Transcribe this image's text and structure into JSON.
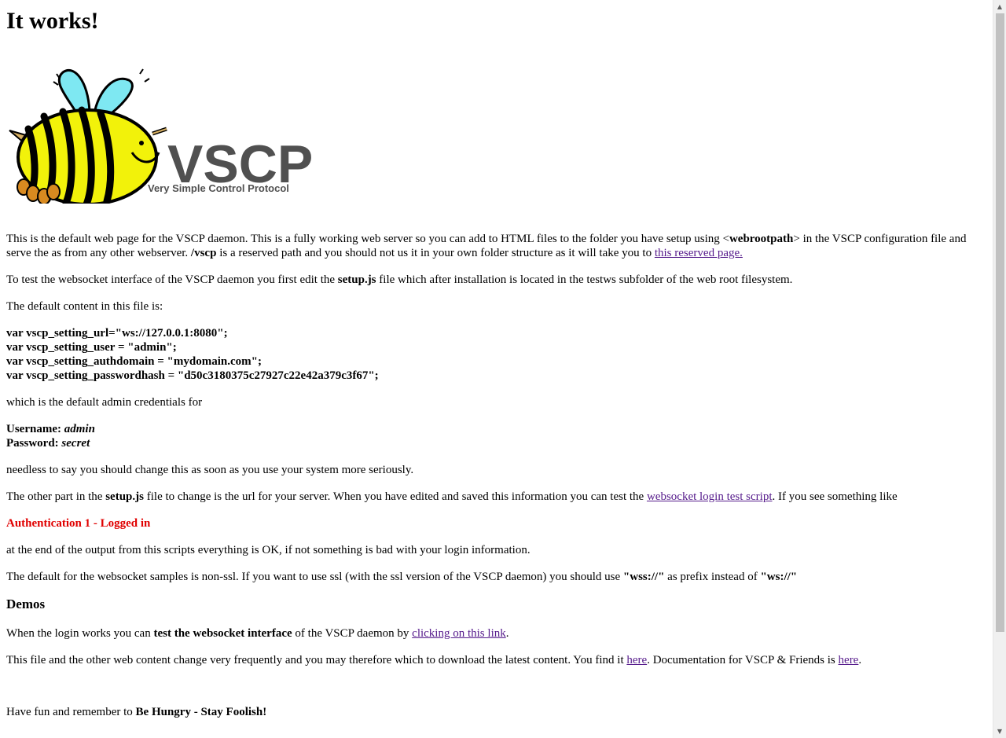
{
  "title": "It works!",
  "logo": {
    "wordmark": "VSCP",
    "tagline": "Very Simple Control Protocol"
  },
  "intro": {
    "t1": "This is the default web page for the VSCP daemon. This is a fully working web server so you can add to HTML files to the folder you have setup using <",
    "b1": "webrootpath",
    "t2": "> in the VSCP configuration file and serve the as from any other webserver. ",
    "b2": "/vscp",
    "t3": " is a reserved path and you should not us it in your own folder structure as it will take you to ",
    "link": "this reserved page."
  },
  "websocket": {
    "t1": "To test the websocket interface of the VSCP daemon you first edit the ",
    "b1": "setup.js",
    "t2": " file which after installation is located in the testws subfolder of the web root filesystem."
  },
  "default_content": "The default content in this file is:",
  "code_lines": [
    "var vscp_setting_url=\"ws://127.0.0.1:8080\";",
    "var vscp_setting_user = \"admin\";",
    "var vscp_setting_authdomain = \"mydomain.com\";",
    "var vscp_setting_passwordhash = \"d50c3180375c27927c22e42a379c3f67\";"
  ],
  "admin_creds_text": "which is the default admin credentials for",
  "credentials": {
    "username_label": "Username: ",
    "username": "admin",
    "password_label": "Password: ",
    "password": "secret"
  },
  "needless": "needless to say you should change this as soon as you use your system more seriously.",
  "other_part": {
    "t1": "The other part in the ",
    "b1": "setup.js",
    "t2": " file to change is the url for your server. When you have edited and saved this information you can test the ",
    "link": "websocket login test script",
    "t3": ". If you see something like"
  },
  "auth_status": "Authentication 1 - Logged in",
  "end_output": "at the end of the output from this scripts everything is OK, if not something is bad with your login information.",
  "ssl": {
    "t1": "The default for the websocket samples is non-ssl. If you want to use ssl (with the ssl version of the VSCP daemon) you should use ",
    "b1": "\"wss://\"",
    "t2": " as prefix instead of ",
    "b2": "\"ws://\""
  },
  "demos_heading": "Demos",
  "demos": {
    "t1": "When the login works you can ",
    "b1": "test the websocket interface",
    "t2": " of the VSCP daemon by ",
    "link": "clicking on this link",
    "t3": "."
  },
  "download": {
    "t1": "This file and the other web content change very frequently and you may therefore which to download the latest content. You find it ",
    "link1": "here",
    "t2": ". Documentation for VSCP & Friends is ",
    "link2": "here",
    "t3": "."
  },
  "footer": {
    "t1": "Have fun and remember to ",
    "b1": "Be Hungry - Stay Foolish!"
  },
  "colors": {
    "link": "#551a8b",
    "auth_red": "#e00000",
    "bee_yellow": "#f2f20a",
    "wing_blue": "#7ee8f2",
    "logo_gray": "#505050"
  }
}
